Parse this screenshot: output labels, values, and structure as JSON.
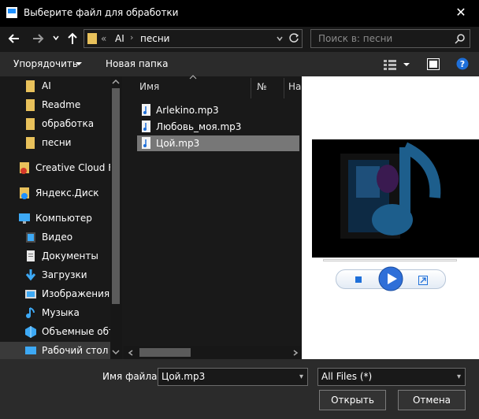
{
  "window": {
    "title": "Выберите файл для обработки",
    "close_label": "✕"
  },
  "nav": {
    "path_prefix": "«",
    "path_items": [
      "AI",
      "песни"
    ],
    "search_placeholder": "Поиск в: песни"
  },
  "toolbar": {
    "organize_label": "Упорядочить",
    "new_folder_label": "Новая папка"
  },
  "sidebar": {
    "items": [
      {
        "label": "AI",
        "icon": "folder-icon"
      },
      {
        "label": "Readme",
        "icon": "folder-icon"
      },
      {
        "label": "обработка",
        "icon": "folder-icon"
      },
      {
        "label": "песни",
        "icon": "folder-icon"
      },
      {
        "label": "Creative Cloud Fil",
        "icon": "creative-cloud-icon"
      },
      {
        "label": "Яндекс.Диск",
        "icon": "yandex-disk-icon"
      },
      {
        "label": "Компьютер",
        "icon": "computer-icon"
      },
      {
        "label": "Видео",
        "icon": "video-icon"
      },
      {
        "label": "Документы",
        "icon": "documents-icon"
      },
      {
        "label": "Загрузки",
        "icon": "downloads-icon"
      },
      {
        "label": "Изображения",
        "icon": "pictures-icon"
      },
      {
        "label": "Музыка",
        "icon": "music-icon"
      },
      {
        "label": "Объемные объ",
        "icon": "3d-objects-icon"
      },
      {
        "label": "Рабочий стол",
        "icon": "desktop-icon"
      }
    ]
  },
  "file_list": {
    "columns": [
      "Имя",
      "№",
      "На"
    ],
    "files": [
      {
        "name": "Arlekino.mp3",
        "selected": false
      },
      {
        "name": "Любовь_моя.mp3",
        "selected": false
      },
      {
        "name": "Цой.mp3",
        "selected": true
      }
    ]
  },
  "bottom": {
    "filename_label": "Имя файла:",
    "filename_value": "Цой.mp3",
    "filetype_value": "All Files (*)",
    "open_label": "Открыть",
    "cancel_label": "Отмена"
  },
  "colors": {
    "folder": "#e8c15b",
    "accent": "#1e90ff",
    "selected_row": "#777777"
  }
}
